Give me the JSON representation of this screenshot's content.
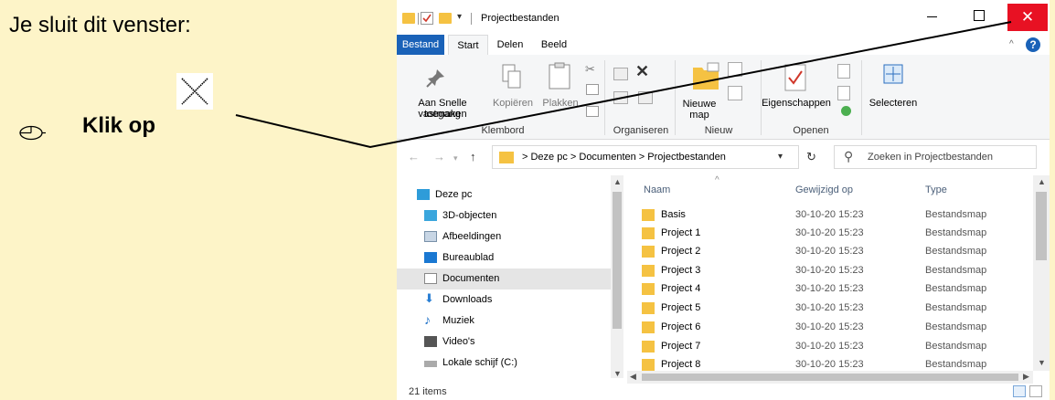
{
  "instruction": {
    "title": "Je sluit dit venster:",
    "action_text": "Klik op",
    "mouse_icon": "mouse-icon",
    "close_glyph": "×"
  },
  "window": {
    "title": "Projectbestanden",
    "close_glyph": "✕",
    "tabs": [
      "Bestand",
      "Start",
      "Delen",
      "Beeld"
    ],
    "active_tab": "Start",
    "help_glyph": "?",
    "accent_color": "#1a62b8",
    "close_color": "#e81123"
  },
  "ribbon": {
    "pin_label_1": "Aan Snelle toegang",
    "pin_label_2": "vastmaken",
    "copy_label": "Kopiëren",
    "paste_label": "Plakken",
    "new_folder_label_1": "Nieuwe",
    "new_folder_label_2": "map",
    "properties_label": "Eigenschappen",
    "select_label": "Selecteren",
    "groups": [
      "Klembord",
      "Organiseren",
      "Nieuw",
      "Openen"
    ]
  },
  "address": {
    "path": "> Deze pc  >  Documenten  >  Projectbestanden",
    "search_placeholder": "Zoeken in Projectbestanden"
  },
  "nav": {
    "items": [
      {
        "label": "Deze pc",
        "icon": "pc-icon"
      },
      {
        "label": "3D-objecten",
        "icon": "cube-icon"
      },
      {
        "label": "Afbeeldingen",
        "icon": "pictures-icon"
      },
      {
        "label": "Bureaublad",
        "icon": "desktop-icon"
      },
      {
        "label": "Documenten",
        "icon": "documents-icon",
        "selected": true
      },
      {
        "label": "Downloads",
        "icon": "download-icon"
      },
      {
        "label": "Muziek",
        "icon": "music-icon"
      },
      {
        "label": "Video's",
        "icon": "video-icon"
      },
      {
        "label": "Lokale schijf (C:)",
        "icon": "drive-icon"
      }
    ]
  },
  "files": {
    "columns": [
      "Naam",
      "Gewijzigd op",
      "Type"
    ],
    "rows": [
      {
        "name": "Basis",
        "date": "30-10-20 15:23",
        "type": "Bestandsmap"
      },
      {
        "name": "Project 1",
        "date": "30-10-20 15:23",
        "type": "Bestandsmap"
      },
      {
        "name": "Project 2",
        "date": "30-10-20 15:23",
        "type": "Bestandsmap"
      },
      {
        "name": "Project 3",
        "date": "30-10-20 15:23",
        "type": "Bestandsmap"
      },
      {
        "name": "Project 4",
        "date": "30-10-20 15:23",
        "type": "Bestandsmap"
      },
      {
        "name": "Project 5",
        "date": "30-10-20 15:23",
        "type": "Bestandsmap"
      },
      {
        "name": "Project 6",
        "date": "30-10-20 15:23",
        "type": "Bestandsmap"
      },
      {
        "name": "Project 7",
        "date": "30-10-20 15:23",
        "type": "Bestandsmap"
      },
      {
        "name": "Project 8",
        "date": "30-10-20 15:23",
        "type": "Bestandsmap"
      }
    ]
  },
  "status": {
    "items_text": "21 items"
  }
}
